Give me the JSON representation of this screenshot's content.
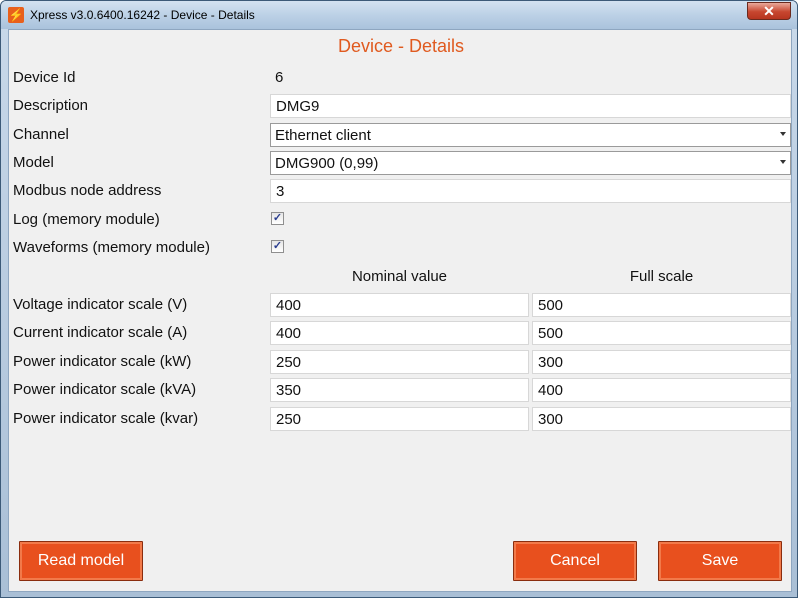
{
  "window": {
    "title": "Xpress v3.0.6400.16242 - Device - Details",
    "close_glyph": "✕",
    "app_icon_glyph": "⚡"
  },
  "heading": "Device - Details",
  "form": {
    "device_id": {
      "label": "Device Id",
      "value": "6"
    },
    "description": {
      "label": "Description",
      "value": "DMG9"
    },
    "channel": {
      "label": "Channel",
      "value": "Ethernet client"
    },
    "model": {
      "label": "Model",
      "value": "DMG900 (0,99)"
    },
    "modbus": {
      "label": "Modbus node address",
      "value": "3"
    },
    "log": {
      "label": "Log (memory module)",
      "checked": true
    },
    "waveforms": {
      "label": "Waveforms (memory module)",
      "checked": true
    }
  },
  "scales": {
    "headers": {
      "nominal": "Nominal value",
      "full": "Full scale"
    },
    "rows": [
      {
        "label": "Voltage indicator scale (V)",
        "nominal": "400",
        "full": "500"
      },
      {
        "label": "Current indicator scale (A)",
        "nominal": "400",
        "full": "500"
      },
      {
        "label": "Power indicator scale (kW)",
        "nominal": "250",
        "full": "300"
      },
      {
        "label": "Power indicator scale (kVA)",
        "nominal": "350",
        "full": "400"
      },
      {
        "label": "Power indicator scale (kvar)",
        "nominal": "250",
        "full": "300"
      }
    ]
  },
  "buttons": {
    "read_model": "Read model",
    "cancel": "Cancel",
    "save": "Save"
  },
  "colors": {
    "accent": "#e8501e",
    "heading": "#e05a1f"
  }
}
